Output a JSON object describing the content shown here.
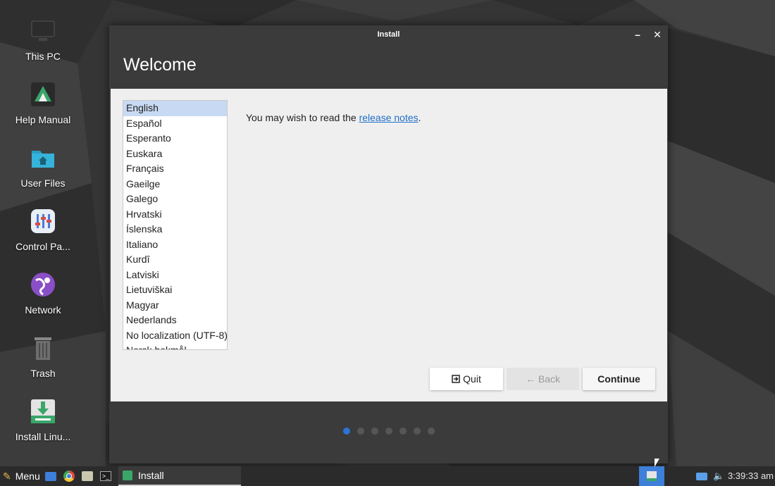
{
  "desktop": {
    "icons": [
      {
        "label": "This PC",
        "icon": "computer-icon"
      },
      {
        "label": "Help Manual",
        "icon": "help-manual-icon"
      },
      {
        "label": "User Files",
        "icon": "home-folder-icon"
      },
      {
        "label": "Control Pa...",
        "icon": "control-panel-icon"
      },
      {
        "label": "Network",
        "icon": "network-globe-icon"
      },
      {
        "label": "Trash",
        "icon": "trash-icon"
      },
      {
        "label": "Install Linu...",
        "icon": "installer-icon"
      }
    ]
  },
  "window": {
    "title": "Install",
    "minimize": "–",
    "close": "✕",
    "heading": "Welcome",
    "languages": [
      "English",
      "Español",
      "Esperanto",
      "Euskara",
      "Français",
      "Gaeilge",
      "Galego",
      "Hrvatski",
      "Íslenska",
      "Italiano",
      "Kurdî",
      "Latviski",
      "Lietuviškai",
      "Magyar",
      "Nederlands",
      "No localization (UTF-8)",
      "Norsk bokmål"
    ],
    "selected_language": "English",
    "notes_prefix": "You may wish to read the ",
    "notes_link": "release notes",
    "notes_suffix": ".",
    "buttons": {
      "quit": "Quit",
      "back": "Back",
      "continue": "Continue"
    },
    "progress": {
      "steps": 7,
      "current": 1
    }
  },
  "taskbar": {
    "menu_label": "Menu",
    "active_task": "Install",
    "clock": "3:39:33 am"
  },
  "colors": {
    "accent": "#2d73d6",
    "selection": "#c8d9f3",
    "link": "#1f6fc5"
  }
}
